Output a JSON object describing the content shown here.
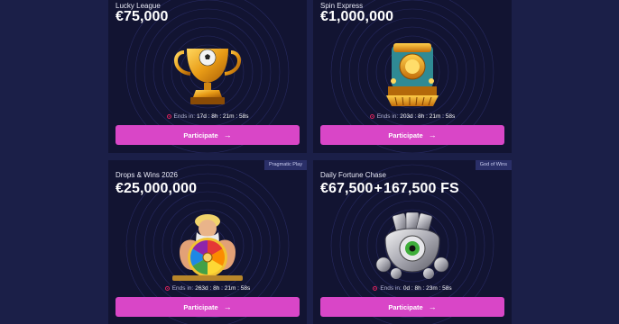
{
  "colors": {
    "page_bg": "#1b1f48",
    "card_bg": "#121432",
    "button": "#d946c7",
    "timer_icon": "#e0245e",
    "badge_bg": "#2a2f68"
  },
  "cards": [
    {
      "title": "Lucky League",
      "prize": "€75,000",
      "art_icon": "trophy-football-icon",
      "timer_label": "Ends in:",
      "timer_value": "17d : 8h : 21m : 58s",
      "button_label": "Participate"
    },
    {
      "title": "Spin Express",
      "prize": "€1,000,000",
      "art_icon": "train-coin-icon",
      "timer_label": "Ends in:",
      "timer_value": "203d : 8h : 21m : 58s",
      "button_label": "Participate"
    },
    {
      "title": "Drops & Wins 2026",
      "prize": "€25,000,000",
      "provider": "Pragmatic Play",
      "art_icon": "zeus-wheel-icon",
      "timer_label": "Ends in:",
      "timer_value": "263d : 8h : 21m : 58s",
      "button_label": "Participate"
    },
    {
      "title": "Daily Fortune Chase",
      "prize_main": "€67,500",
      "prize_sep": "+",
      "prize_extra": "167,500 FS",
      "provider": "God of Wins",
      "art_icon": "silver-eye-horseshoe-icon",
      "timer_label": "Ends in:",
      "timer_value": "0d : 8h : 23m : 58s",
      "button_label": "Participate"
    }
  ]
}
